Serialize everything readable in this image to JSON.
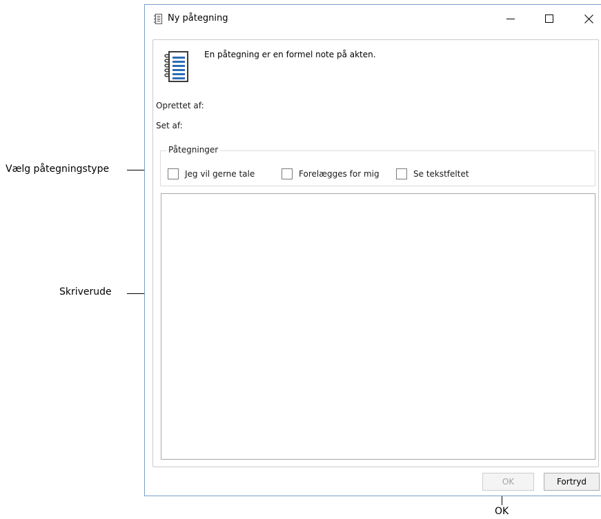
{
  "annotations": {
    "type_label": "Vælg påtegningstype",
    "editor_label": "Skriverude",
    "ok_label": "OK"
  },
  "window": {
    "title": "Ny påtegning",
    "icon": "notebook-icon",
    "controls": [
      "minimize-icon",
      "maximize-icon",
      "close-icon"
    ]
  },
  "content": {
    "description": "En påtegning er en formel note på akten.",
    "created_by_label": "Oprettet af:",
    "seen_by_label": "Set af:",
    "group_title": "Påtegninger",
    "checkboxes": [
      {
        "label": "Jeg vil gerne tale",
        "checked": false
      },
      {
        "label": "Forelægges for mig",
        "checked": false
      },
      {
        "label": "Se tekstfeltet",
        "checked": false
      }
    ],
    "text_value": ""
  },
  "buttons": {
    "ok": "OK",
    "cancel": "Fortryd"
  },
  "colors": {
    "window_border": "#7a9ec9",
    "icon_blue": "#2b6cb5",
    "disabled_text": "#a3a3a3"
  }
}
